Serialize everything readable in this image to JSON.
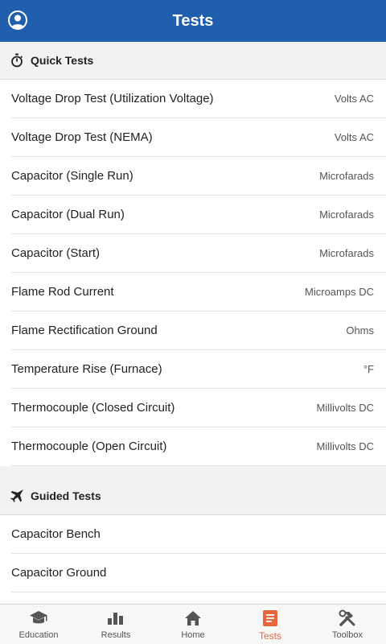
{
  "header": {
    "title": "Tests",
    "profile_icon": "user-profile-icon"
  },
  "quick_tests": {
    "label": "Quick Tests",
    "icon": "stopwatch-icon",
    "items": [
      {
        "label": "Voltage Drop Test (Utilization Voltage)",
        "unit": "Volts AC"
      },
      {
        "label": "Voltage Drop Test (NEMA)",
        "unit": "Volts AC"
      },
      {
        "label": "Capacitor (Single Run)",
        "unit": "Microfarads"
      },
      {
        "label": "Capacitor (Dual Run)",
        "unit": "Microfarads"
      },
      {
        "label": "Capacitor (Start)",
        "unit": "Microfarads"
      },
      {
        "label": "Flame Rod Current",
        "unit": "Microamps DC"
      },
      {
        "label": "Flame Rectification Ground",
        "unit": "Ohms"
      },
      {
        "label": "Temperature Rise (Furnace)",
        "unit": "°F"
      },
      {
        "label": "Thermocouple (Closed Circuit)",
        "unit": "Millivolts DC"
      },
      {
        "label": "Thermocouple (Open Circuit)",
        "unit": "Millivolts DC"
      }
    ]
  },
  "guided_tests": {
    "label": "Guided Tests",
    "icon": "jet-icon",
    "items": [
      {
        "label": "Capacitor Bench"
      },
      {
        "label": "Capacitor Ground"
      }
    ]
  },
  "tabbar": {
    "items": [
      {
        "label": "Education",
        "icon": "graduation-cap-icon",
        "active": false
      },
      {
        "label": "Results",
        "icon": "bar-chart-icon",
        "active": false
      },
      {
        "label": "Home",
        "icon": "home-icon",
        "active": false
      },
      {
        "label": "Tests",
        "icon": "clipboard-list-icon",
        "active": true
      },
      {
        "label": "Toolbox",
        "icon": "tools-icon",
        "active": false
      }
    ]
  },
  "colors": {
    "header": "#1f5fae",
    "active_tab": "#e8663c",
    "inactive_tab": "#555555",
    "section_bg": "#f2f2f2"
  }
}
